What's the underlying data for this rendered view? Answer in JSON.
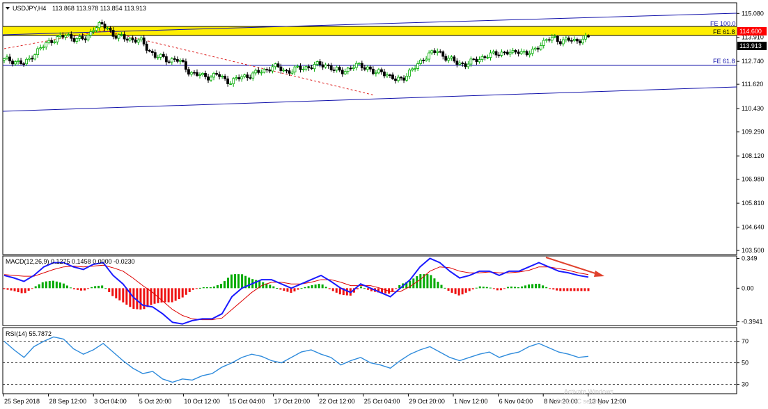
{
  "header": {
    "symbol": "USDJPY,H4",
    "ohlc": "113.868 113.978 113.854 113.913"
  },
  "price_labels": {
    "current": "113.913",
    "fe_zone": "114.600",
    "fe100": "FE 100.0",
    "fe618_top": "FE 61.8",
    "fe618_low": "FE 61.8"
  },
  "colors": {
    "bull": "#00aa00",
    "bear": "#000000",
    "trend": "#1111aa",
    "zone": "#ffee00",
    "dashed": "#dd2222",
    "macd_line": "#1a1aff",
    "signal_line": "#dd0000",
    "hist_pos": "#00aa00",
    "hist_neg": "#ee1111",
    "rsi": "#2e8bdc",
    "label_bg": "#ff0000",
    "current_bg": "#000000"
  },
  "macd": {
    "label": "MACD(12,26,9) 0.1275 0.1458 0.0000 -0.0230"
  },
  "rsi": {
    "label": "RSI(14) 55.7872"
  },
  "watermark": {
    "line1": "Activate Windows",
    "line2": "Go to PC settings"
  },
  "chart_data": [
    {
      "type": "candlestick",
      "title": "",
      "ylim": [
        103.3,
        115.6
      ],
      "yticks": [
        "115.080",
        "113.910",
        "112.740",
        "111.620",
        "110.430",
        "109.290",
        "108.120",
        "106.980",
        "105.810",
        "104.640",
        "103.500"
      ],
      "xticks": [
        "25 Sep 2018",
        "28 Sep 12:00",
        "3 Oct 04:00",
        "5 Oct 20:00",
        "10 Oct 12:00",
        "15 Oct 04:00",
        "17 Oct 20:00",
        "22 Oct 12:00",
        "25 Oct 04:00",
        "29 Oct 20:00",
        "1 Nov 12:00",
        "6 Nov 04:00",
        "8 Nov 20:00",
        "13 Nov 12:00"
      ],
      "close_path": [
        112.8,
        112.8,
        112.7,
        112.6,
        113.0,
        113.3,
        113.55,
        113.8,
        113.9,
        114.0,
        113.9,
        113.8,
        113.85,
        114.4,
        114.5,
        114.4,
        114.0,
        113.9,
        113.85,
        113.8,
        113.7,
        113.3,
        113.0,
        112.9,
        112.8,
        112.85,
        112.6,
        112.2,
        112.1,
        112.0,
        112.0,
        112.1,
        111.85,
        111.75,
        111.9,
        112.0,
        112.1,
        112.2,
        112.3,
        112.5,
        112.4,
        112.25,
        112.3,
        112.4,
        112.45,
        112.5,
        112.6,
        112.55,
        112.3,
        112.25,
        112.35,
        112.5,
        112.55,
        112.4,
        112.1,
        112.3,
        112.0,
        111.8,
        111.95,
        112.2,
        112.5,
        112.9,
        113.1,
        113.25,
        113.0,
        112.8,
        112.65,
        112.6,
        112.7,
        112.85,
        113.0,
        113.05,
        113.15,
        113.2,
        113.1,
        113.3,
        113.1,
        113.2,
        113.6,
        113.8,
        113.85,
        113.75,
        113.8,
        113.7,
        113.85,
        113.9
      ]
    },
    {
      "type": "line",
      "title": "",
      "series": [
        {
          "values": [
            0.15,
            0.12,
            0.08,
            0.15,
            0.25,
            0.3,
            0.3,
            0.25,
            0.22,
            0.28,
            0.3,
            0.15,
            0.05,
            -0.1,
            -0.2,
            -0.22,
            -0.3,
            -0.4,
            -0.42,
            -0.38,
            -0.36,
            -0.36,
            -0.3,
            -0.1,
            0.0,
            0.05,
            0.1,
            0.1,
            0.05,
            0.0,
            0.05,
            0.1,
            0.15,
            0.08,
            0.0,
            -0.05,
            0.05,
            0.0,
            -0.05,
            -0.1,
            0.0,
            0.1,
            0.25,
            0.35,
            0.3,
            0.2,
            0.12,
            0.15,
            0.2,
            0.2,
            0.15,
            0.2,
            0.2,
            0.25,
            0.3,
            0.25,
            0.2,
            0.18,
            0.15,
            0.13
          ]
        },
        {
          "values": [
            0.16,
            0.15,
            0.14,
            0.14,
            0.18,
            0.22,
            0.25,
            0.26,
            0.25,
            0.26,
            0.27,
            0.24,
            0.2,
            0.12,
            0.03,
            -0.05,
            -0.15,
            -0.25,
            -0.32,
            -0.36,
            -0.37,
            -0.37,
            -0.35,
            -0.25,
            -0.15,
            -0.05,
            0.03,
            0.07,
            0.07,
            0.05,
            0.05,
            0.07,
            0.1,
            0.1,
            0.07,
            0.03,
            0.03,
            0.03,
            0.0,
            -0.04,
            -0.04,
            0.02,
            0.1,
            0.2,
            0.25,
            0.24,
            0.2,
            0.18,
            0.18,
            0.19,
            0.18,
            0.18,
            0.19,
            0.21,
            0.25,
            0.25,
            0.23,
            0.21,
            0.18,
            0.16
          ]
        }
      ],
      "ylim": [
        -0.43,
        0.37
      ],
      "yticks": [
        "0.349",
        "0.00",
        "-0.3941"
      ]
    },
    {
      "type": "line",
      "title": "",
      "ylim": [
        22,
        82
      ],
      "levels": [
        "70",
        "50",
        "30"
      ],
      "yticks": [
        "70",
        "50",
        "30"
      ],
      "series": [
        {
          "values": [
            70,
            62,
            55,
            65,
            70,
            74,
            72,
            63,
            58,
            62,
            68,
            60,
            52,
            45,
            40,
            42,
            35,
            32,
            35,
            34,
            38,
            40,
            46,
            50,
            55,
            58,
            56,
            52,
            50,
            55,
            60,
            62,
            58,
            55,
            48,
            52,
            55,
            50,
            48,
            45,
            52,
            58,
            62,
            65,
            60,
            55,
            52,
            55,
            58,
            60,
            55,
            58,
            60,
            65,
            68,
            64,
            60,
            58,
            55,
            56
          ]
        }
      ]
    }
  ]
}
